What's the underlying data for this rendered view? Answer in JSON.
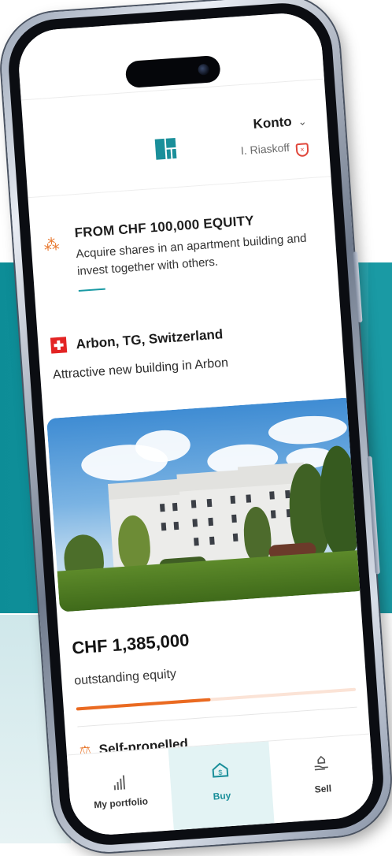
{
  "header": {
    "account_label": "Konto",
    "user_name": "I. Riaskoff"
  },
  "promo": {
    "title": "FROM CHF 100,000 EQUITY",
    "description": "Acquire shares in an apartment building and invest together with others."
  },
  "listing": {
    "location": "Arbon, TG, Switzerland",
    "subtitle": "Attractive new building in Arbon",
    "price": "CHF 1,385,000",
    "price_caption": "outstanding equity",
    "progress": 0.48,
    "feature": "Self-propelled"
  },
  "tabs": [
    {
      "label": "My portfolio",
      "icon": "bar-chart-icon"
    },
    {
      "label": "Buy",
      "icon": "house-dollar-icon",
      "active": true
    },
    {
      "label": "Sell",
      "icon": "hand-house-icon"
    }
  ],
  "colors": {
    "brand": "#1a8f9a",
    "accent": "#ea6a21",
    "flag": "#e32424"
  }
}
